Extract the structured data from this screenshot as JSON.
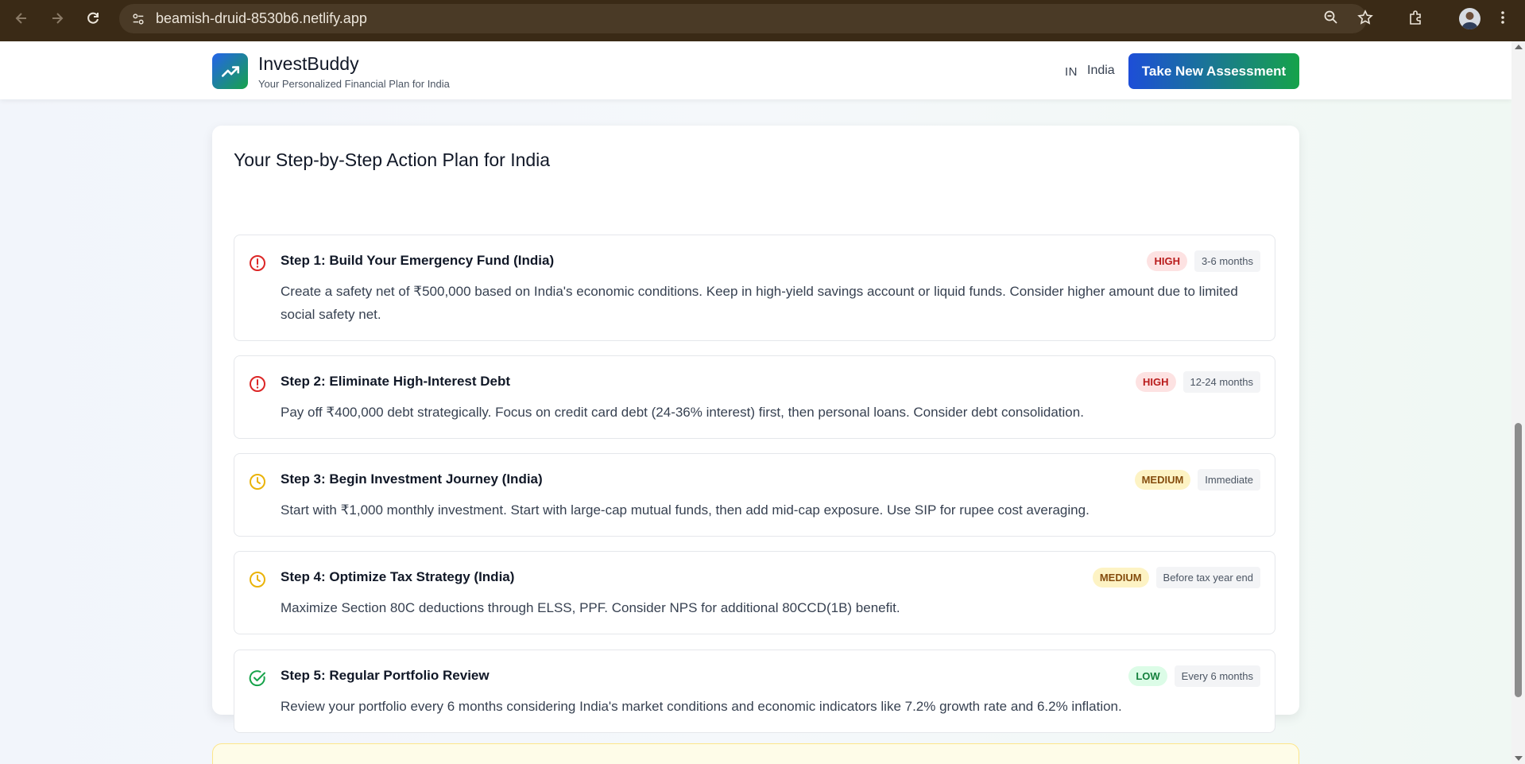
{
  "browser": {
    "url": "beamish-druid-8530b6.netlify.app",
    "icons": [
      "back-icon",
      "forward-icon",
      "reload-icon",
      "site-info-icon",
      "zoom-icon",
      "bookmark-star-icon",
      "extensions-icon",
      "profile-avatar",
      "menu-dots-icon"
    ]
  },
  "header": {
    "app_name": "InvestBuddy",
    "tagline": "Your Personalized Financial Plan for India",
    "country_code": "IN",
    "country_name": "India",
    "cta_label": "Take New Assessment"
  },
  "plan": {
    "title": "Your Step-by-Step Action Plan for India",
    "steps": [
      {
        "title": "Step 1: Build Your Emergency Fund (India)",
        "description": "Create a safety net of ₹500,000 based on India's economic conditions. Keep in high-yield savings account or liquid funds. Consider higher amount due to limited social safety net.",
        "priority": "HIGH",
        "timeframe": "3-6 months",
        "icon": "alert-circle-icon"
      },
      {
        "title": "Step 2: Eliminate High-Interest Debt",
        "description": "Pay off ₹400,000 debt strategically. Focus on credit card debt (24-36% interest) first, then personal loans. Consider debt consolidation.",
        "priority": "HIGH",
        "timeframe": "12-24 months",
        "icon": "alert-circle-icon"
      },
      {
        "title": "Step 3: Begin Investment Journey (India)",
        "description": "Start with ₹1,000 monthly investment. Start with large-cap mutual funds, then add mid-cap exposure. Use SIP for rupee cost averaging.",
        "priority": "MEDIUM",
        "timeframe": "Immediate",
        "icon": "clock-icon"
      },
      {
        "title": "Step 4: Optimize Tax Strategy (India)",
        "description": "Maximize Section 80C deductions through ELSS, PPF. Consider NPS for additional 80CCD(1B) benefit.",
        "priority": "MEDIUM",
        "timeframe": "Before tax year end",
        "icon": "clock-icon"
      },
      {
        "title": "Step 5: Regular Portfolio Review",
        "description": "Review your portfolio every 6 months considering India's market conditions and economic indicators like 7.2% growth rate and 6.2% inflation.",
        "priority": "LOW",
        "timeframe": "Every 6 months",
        "icon": "check-circle-icon"
      }
    ]
  },
  "colors": {
    "high": "#dc2626",
    "medium": "#eab308",
    "low": "#16a34a",
    "brand_gradient_start": "#1d4ed8",
    "brand_gradient_end": "#16a34a"
  }
}
